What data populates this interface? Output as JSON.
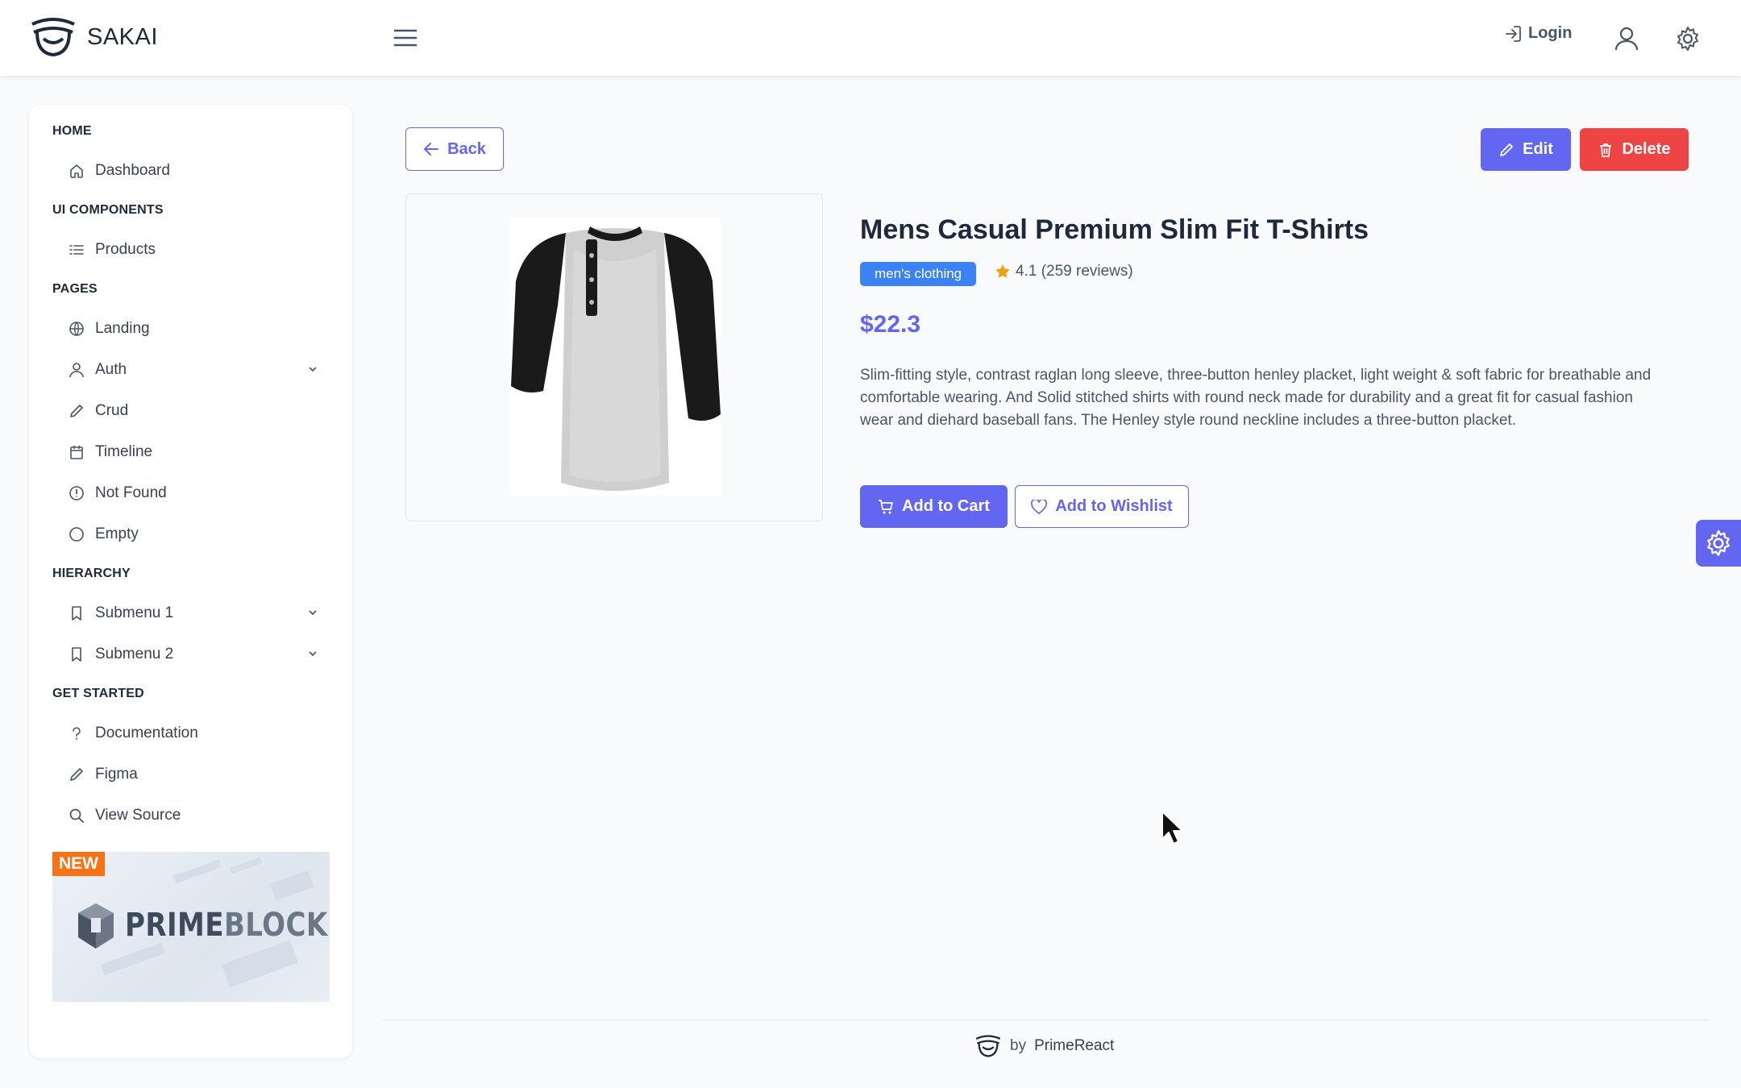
{
  "topbar": {
    "logo_text": "SAKAI",
    "login_label": "Login"
  },
  "sidebar": {
    "sections": [
      {
        "title": "HOME",
        "items": [
          {
            "label": "Dashboard",
            "icon": "home-icon"
          }
        ]
      },
      {
        "title": "UI COMPONENTS",
        "items": [
          {
            "label": "Products",
            "icon": "list-icon"
          }
        ]
      },
      {
        "title": "PAGES",
        "items": [
          {
            "label": "Landing",
            "icon": "globe-icon"
          },
          {
            "label": "Auth",
            "icon": "user-icon",
            "expandable": true
          },
          {
            "label": "Crud",
            "icon": "pencil-icon"
          },
          {
            "label": "Timeline",
            "icon": "calendar-icon"
          },
          {
            "label": "Not Found",
            "icon": "exclamation-circle-icon"
          },
          {
            "label": "Empty",
            "icon": "circle-icon"
          }
        ]
      },
      {
        "title": "HIERARCHY",
        "items": [
          {
            "label": "Submenu 1",
            "icon": "bookmark-icon",
            "expandable": true
          },
          {
            "label": "Submenu 2",
            "icon": "bookmark-icon",
            "expandable": true
          }
        ]
      },
      {
        "title": "GET STARTED",
        "items": [
          {
            "label": "Documentation",
            "icon": "question-icon"
          },
          {
            "label": "Figma",
            "icon": "pencil-icon"
          },
          {
            "label": "View Source",
            "icon": "search-icon"
          }
        ]
      }
    ],
    "banner": {
      "badge": "NEW",
      "title_a": "PRIME",
      "title_b": "BLOCKS"
    }
  },
  "toolbar": {
    "back_label": "Back",
    "edit_label": "Edit",
    "delete_label": "Delete"
  },
  "product": {
    "title": "Mens Casual Premium Slim Fit T-Shirts",
    "category": "men's clothing",
    "rating_text": "4.1 (259 reviews)",
    "price": "$22.3",
    "description": "Slim-fitting style, contrast raglan long sleeve, three-button henley placket, light weight & soft fabric for breathable and comfortable wearing. And Solid stitched shirts with round neck made for durability and a great fit for casual fashion wear and diehard baseball fans. The Henley style round neckline includes a three-button placket.",
    "add_to_cart_label": "Add to Cart",
    "add_to_wishlist_label": "Add to Wishlist"
  },
  "footer": {
    "by": "by",
    "brand": "PrimeReact"
  },
  "colors": {
    "primary": "#6366f1",
    "danger": "#ef4444",
    "tag": "#3b82f6",
    "star": "#f59e0b",
    "badge": "#f97316"
  }
}
